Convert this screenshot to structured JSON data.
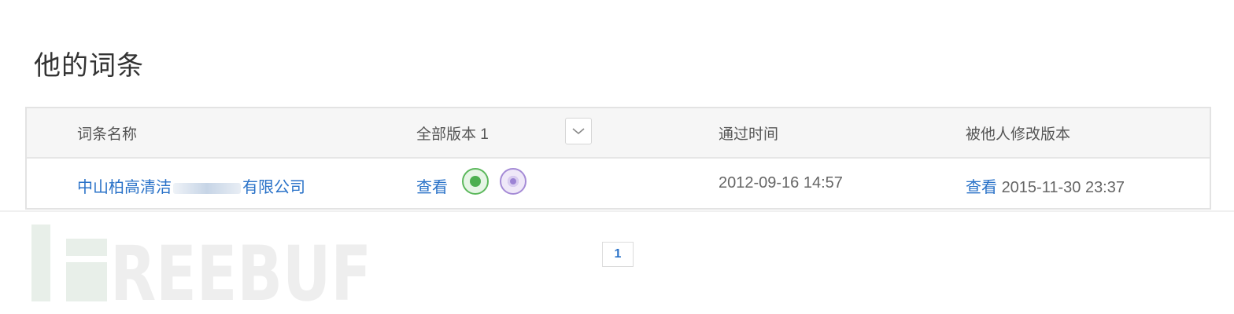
{
  "page": {
    "title": "他的词条"
  },
  "table": {
    "columns": {
      "name": "词条名称",
      "versions": "全部版本 1",
      "passed_time": "通过时间",
      "modified_by_others": "被他人修改版本"
    },
    "rows": [
      {
        "name_prefix": "中山柏高清洁",
        "name_suffix": "有限公司",
        "view_label": "查看",
        "passed_time": "2012-09-16 14:57",
        "others_view_label": "查看",
        "others_time": "2015-11-30 23:37"
      }
    ]
  },
  "pagination": {
    "current_page": "1"
  },
  "watermark": {
    "text": "FREEBUF"
  },
  "colors": {
    "link": "#2a72c8",
    "header_bg": "#f6f6f6",
    "badge_green": "#4caf50",
    "badge_purple": "#9c83d4"
  },
  "icons": {
    "version_toggle": "chevron-down-icon",
    "badges": [
      "green-status-badge-icon",
      "purple-status-badge-icon"
    ]
  }
}
